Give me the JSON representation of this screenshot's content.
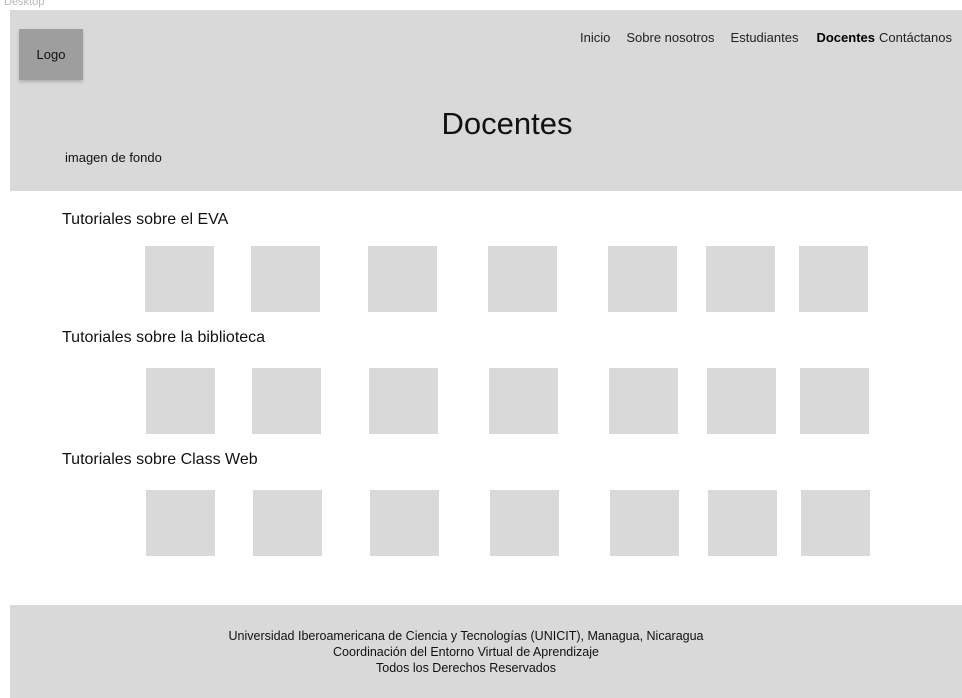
{
  "header": {
    "logo_label": "Logo",
    "nav": [
      {
        "label": "Inicio",
        "active": false
      },
      {
        "label": "Sobre nosotros",
        "active": false
      },
      {
        "label": "Estudiantes",
        "active": false
      },
      {
        "label": "Docentes",
        "active": true
      },
      {
        "label": "Contáctanos",
        "active": false
      }
    ],
    "page_title": "Docentes",
    "background_label": "imagen de fondo"
  },
  "sections": [
    {
      "title": "Tutoriales sobre el EVA",
      "thumbnail_count": 7
    },
    {
      "title": "Tutoriales sobre la biblioteca",
      "thumbnail_count": 7
    },
    {
      "title": "Tutoriales sobre Class Web",
      "thumbnail_count": 7
    }
  ],
  "footer": {
    "line1": "Universidad Iberoamericana de Ciencia y Tecnologías (UNICIT), Managua, Nicaragua",
    "line2": "Coordinación del Entorno Virtual de Aprendizaje",
    "line3": "Todos los Derechos Reservados"
  },
  "colors": {
    "header_bg": "#d9d9d9",
    "logo_bg": "#9e9e9e",
    "thumbnail_bg": "#d9d9d9",
    "footer_bg": "#d9d9d9"
  }
}
